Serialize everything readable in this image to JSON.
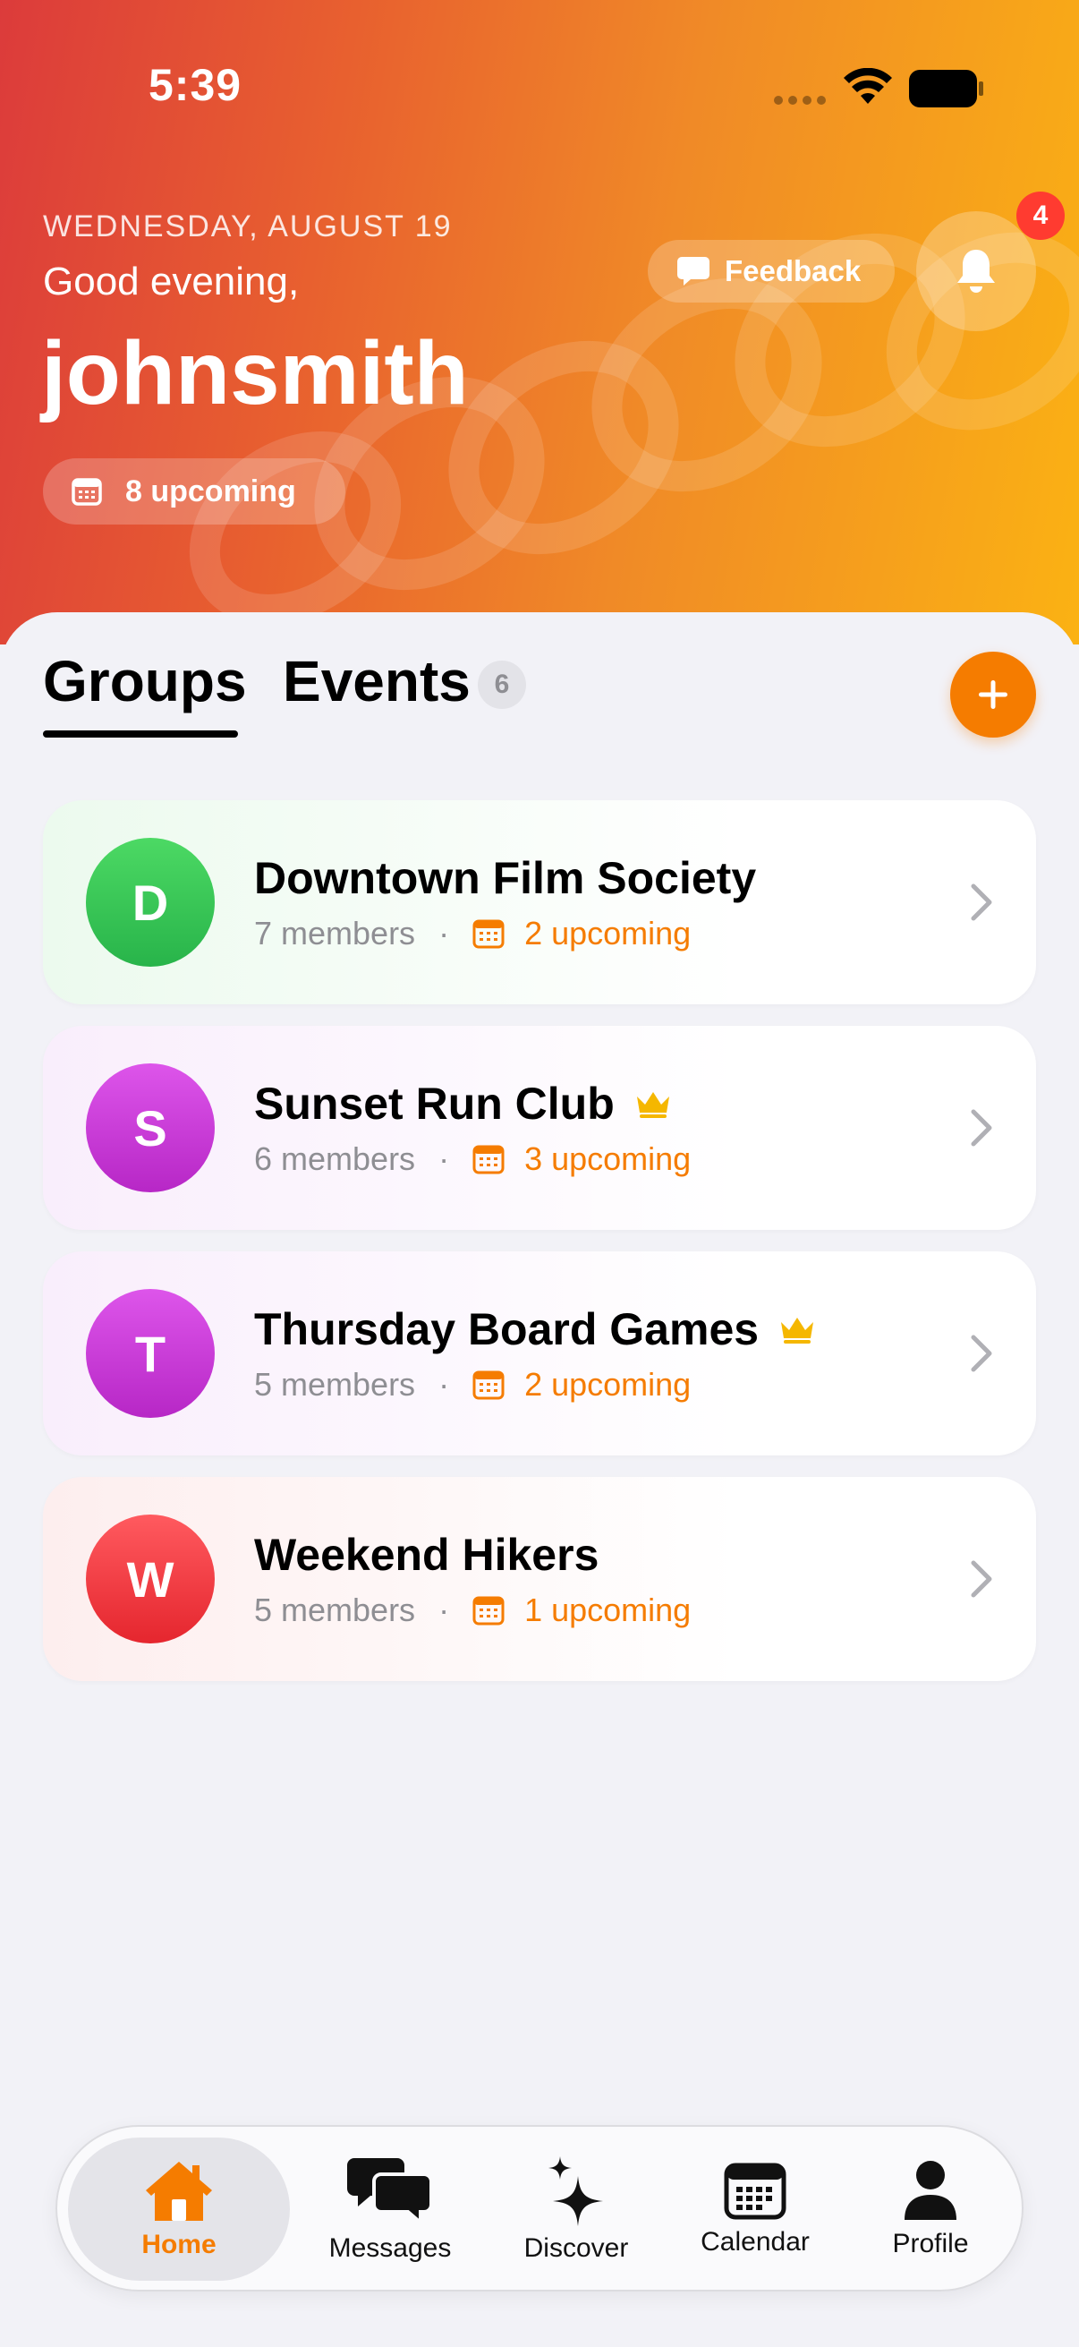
{
  "status_bar": {
    "time": "5:39"
  },
  "header": {
    "date": "WEDNESDAY, AUGUST 19",
    "greeting": "Good evening,",
    "username": "johnsmith",
    "upcoming_label": "8 upcoming",
    "feedback_label": "Feedback",
    "notifications_count": "4"
  },
  "tabs": {
    "groups_label": "Groups",
    "events_label": "Events",
    "events_count": "6"
  },
  "groups": [
    {
      "initial": "D",
      "name": "Downtown Film Society",
      "members": "7 members",
      "separator": "·",
      "upcoming": "2 upcoming",
      "admin": false,
      "avatar_color": "#34c759"
    },
    {
      "initial": "S",
      "name": "Sunset Run Club",
      "members": "6 members",
      "separator": "·",
      "upcoming": "3 upcoming",
      "admin": true,
      "avatar_color": "#c93bd6"
    },
    {
      "initial": "T",
      "name": "Thursday Board Games",
      "members": "5 members",
      "separator": "·",
      "upcoming": "2 upcoming",
      "admin": true,
      "avatar_color": "#c93bd6"
    },
    {
      "initial": "W",
      "name": "Weekend Hikers",
      "members": "5 members",
      "separator": "·",
      "upcoming": "1 upcoming",
      "admin": false,
      "avatar_color": "#f2383f"
    }
  ],
  "tab_bar": {
    "items": [
      {
        "label": "Home",
        "icon": "house-icon",
        "active": true
      },
      {
        "label": "Messages",
        "icon": "chat-bubbles-icon",
        "active": false
      },
      {
        "label": "Discover",
        "icon": "sparkles-icon",
        "active": false
      },
      {
        "label": "Calendar",
        "icon": "calendar-icon",
        "active": false
      },
      {
        "label": "Profile",
        "icon": "person-icon",
        "active": false
      }
    ]
  },
  "colors": {
    "accent": "#f57c00",
    "gradient_start": "#dc3b3b",
    "gradient_end": "#fbb213",
    "badge": "#ff3b30",
    "crown": "#f5b700"
  }
}
